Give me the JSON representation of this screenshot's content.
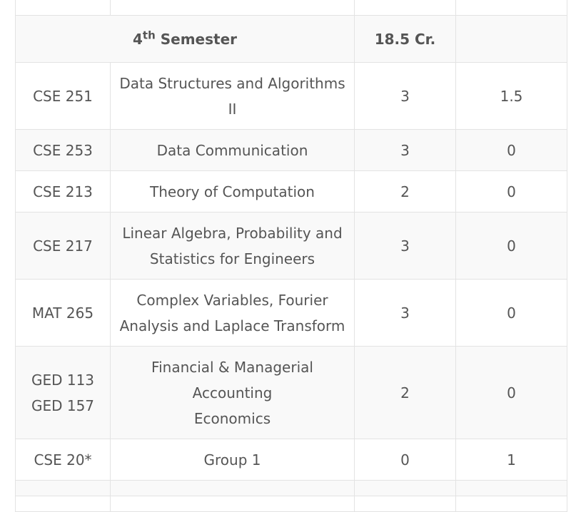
{
  "semester_header": {
    "number": "4",
    "suffix": "th",
    "label": "Semester",
    "credits": "18.5 Cr."
  },
  "courses": [
    {
      "code": [
        "CSE 251"
      ],
      "title": [
        "Data Structures and Algorithms",
        "II"
      ],
      "theory": "3",
      "lab": "1.5"
    },
    {
      "code": [
        "CSE 253"
      ],
      "title": [
        "Data Communication"
      ],
      "theory": "3",
      "lab": "0"
    },
    {
      "code": [
        "CSE 213"
      ],
      "title": [
        "Theory of Computation"
      ],
      "theory": "2",
      "lab": "0"
    },
    {
      "code": [
        "CSE 217"
      ],
      "title": [
        "Linear Algebra, Probability and",
        "Statistics for Engineers"
      ],
      "theory": "3",
      "lab": "0"
    },
    {
      "code": [
        "MAT 265"
      ],
      "title": [
        "Complex Variables, Fourier",
        "Analysis and Laplace Transform"
      ],
      "theory": "3",
      "lab": "0"
    },
    {
      "code": [
        "GED 113",
        "GED 157"
      ],
      "title": [
        "Financial & Managerial",
        "Accounting",
        "Economics"
      ],
      "theory": "2",
      "lab": "0"
    },
    {
      "code": [
        "CSE 20*"
      ],
      "title": [
        "Group 1"
      ],
      "theory": "0",
      "lab": "1"
    }
  ]
}
